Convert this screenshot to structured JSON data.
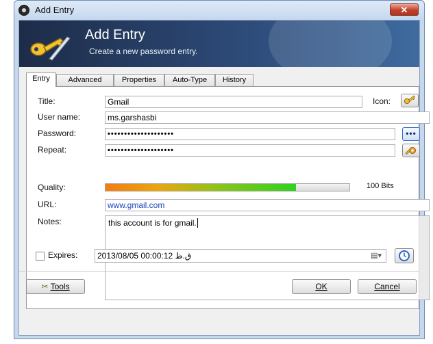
{
  "window": {
    "title": "Add Entry",
    "close_symbol": "✕"
  },
  "banner": {
    "title": "Add Entry",
    "subtitle": "Create a new password entry."
  },
  "tabs": [
    {
      "label": "Entry",
      "active": true
    },
    {
      "label": "Advanced"
    },
    {
      "label": "Properties"
    },
    {
      "label": "Auto-Type"
    },
    {
      "label": "History"
    }
  ],
  "form": {
    "title_label": "Title:",
    "title_value": "Gmail",
    "icon_label": "Icon:",
    "username_label": "User name:",
    "username_value": "ms.garshasbi",
    "password_label": "Password:",
    "password_value": "••••••••••••••••••••",
    "repeat_label": "Repeat:",
    "repeat_value": "••••••••••••••••••••",
    "quality_label": "Quality:",
    "quality_fraction": 0.78,
    "quality_text": "100 Bits",
    "url_label": "URL:",
    "url_value": "www.gmail.com",
    "notes_label": "Notes:",
    "notes_value": "this account is for gmail.",
    "expires_label": "Expires:",
    "expires_value": "ق.ظ 00:00:12 2013/08/05"
  },
  "footer": {
    "tools": "Tools",
    "ok": "OK",
    "cancel": "Cancel"
  },
  "icons": {
    "app": "lock-icon",
    "banner": "key-icon",
    "entry_icon": "key-icon",
    "show_password": "dots-icon",
    "generate_password": "key-gear-icon",
    "calendar": "calendar-dropdown-icon",
    "expiry_presets": "clock-icon",
    "tools": "tools-icon"
  },
  "colors": {
    "banner_dark": "#1d2c48",
    "banner_light": "#3f6b9f",
    "link": "#1c44b8",
    "close": "#c3402b"
  }
}
